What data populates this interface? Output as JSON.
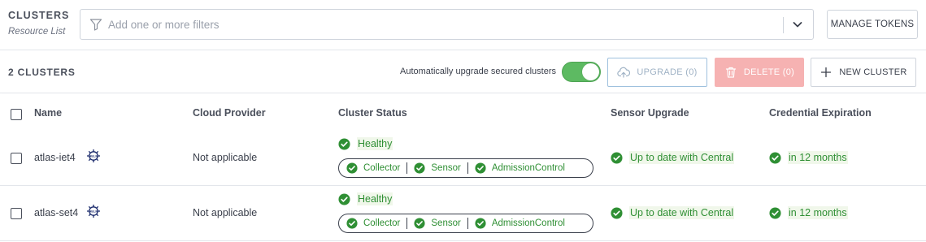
{
  "header": {
    "title": "CLUSTERS",
    "subtitle": "Resource List",
    "filter_placeholder": "Add one or more filters",
    "manage_tokens_label": "MANAGE TOKENS"
  },
  "toolbar": {
    "count_label": "2 CLUSTERS",
    "auto_upgrade_label": "Automatically upgrade secured clusters",
    "auto_upgrade_enabled": true,
    "upgrade_label": "UPGRADE (0)",
    "delete_label": "DELETE (0)",
    "new_cluster_label": "NEW CLUSTER"
  },
  "table": {
    "columns": [
      "Name",
      "Cloud Provider",
      "Cluster Status",
      "Sensor Upgrade",
      "Credential Expiration"
    ],
    "rows": [
      {
        "name": "atlas-iet4",
        "badge_icon": "helm-icon",
        "cloud_provider": "Not applicable",
        "status": "Healthy",
        "components": [
          "Collector",
          "Sensor",
          "AdmissionControl"
        ],
        "sensor_upgrade": "Up to date with Central",
        "credential_expiration": "in 12 months"
      },
      {
        "name": "atlas-set4",
        "badge_icon": "helm-icon",
        "cloud_provider": "Not applicable",
        "status": "Healthy",
        "components": [
          "Collector",
          "Sensor",
          "AdmissionControl"
        ],
        "sensor_upgrade": "Up to date with Central",
        "credential_expiration": "in 12 months"
      }
    ]
  },
  "colors": {
    "healthy_green": "#2f8f34",
    "toggle_on": "#5dba62",
    "delete_disabled": "#f6b2b2",
    "upgrade_border": "#9fc1de",
    "helm_navy": "#1a2a6c"
  }
}
